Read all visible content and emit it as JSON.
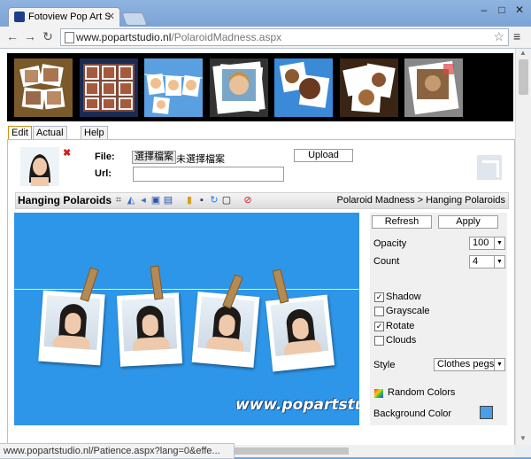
{
  "browser": {
    "tab_title": "Fotoview Pop Art Studio",
    "url_host": "www.popartstudio.nl",
    "url_path": "/PolaroidMadness.aspx",
    "status_text": "www.popartstudio.nl/Patience.aspx?lang=0&effe..."
  },
  "thumbnails": [
    {
      "name": "thumb-1"
    },
    {
      "name": "thumb-2"
    },
    {
      "name": "thumb-3"
    },
    {
      "name": "thumb-4"
    },
    {
      "name": "thumb-5"
    },
    {
      "name": "thumb-6"
    },
    {
      "name": "thumb-7"
    }
  ],
  "tabs": [
    "Edit",
    "Actual Size",
    "Help"
  ],
  "upload": {
    "file_label": "File:",
    "file_button": "選擇檔案",
    "file_status": "未選擇檔案",
    "url_label": "Url:",
    "url_value": "",
    "upload_button": "Upload"
  },
  "toolbar": {
    "title": "Hanging Polaroids",
    "breadcrumb": "Polaroid Madness > Hanging Polaroids"
  },
  "watermark": "www.popartstudio.nl",
  "settings": {
    "refresh": "Refresh",
    "apply": "Apply",
    "opacity_label": "Opacity",
    "opacity_value": "100",
    "count_label": "Count",
    "count_value": "4",
    "shadow_label": "Shadow",
    "shadow_checked": true,
    "grayscale_label": "Grayscale",
    "grayscale_checked": false,
    "rotate_label": "Rotate",
    "rotate_checked": true,
    "clouds_label": "Clouds",
    "clouds_checked": false,
    "style_label": "Style",
    "style_value": "Clothes pegs",
    "random_colors_label": "Random Colors",
    "background_color_label": "Background Color",
    "background_color": "#4a9de8"
  }
}
